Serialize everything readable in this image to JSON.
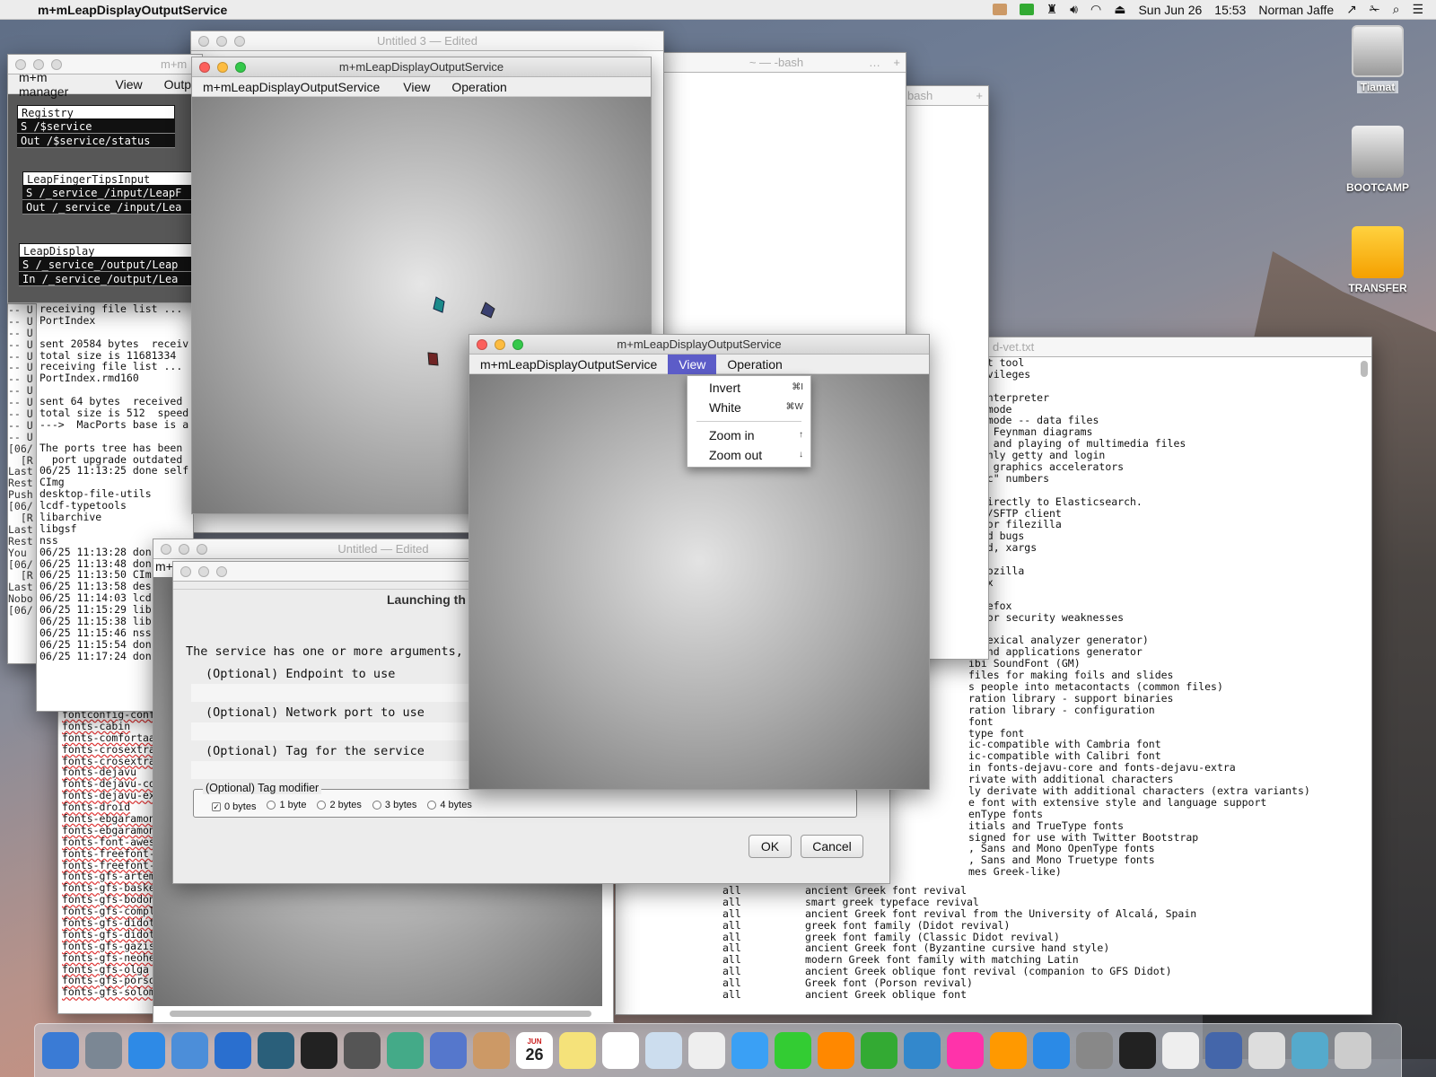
{
  "menubar": {
    "app": "m+mLeapDisplayOutputService",
    "date": "Sun Jun 26",
    "time": "15:53",
    "user": "Norman Jaffe"
  },
  "desktop_icons": [
    {
      "label": "Tiamat"
    },
    {
      "label": "BOOTCAMP"
    },
    {
      "label": "TRANSFER"
    }
  ],
  "manager": {
    "title": "m+m",
    "menu": [
      "m+m manager",
      "View",
      "Outp"
    ],
    "registry": {
      "header": "Registry",
      "lines": [
        "S /$service",
        "Out /$service/status"
      ]
    },
    "fingertips": {
      "header": "LeapFingerTipsInput",
      "lines": [
        "S /_service_/input/LeapF",
        "Out /_service_/input/Lea"
      ]
    },
    "display": {
      "header": "LeapDisplay",
      "lines": [
        "S /_service_/output/Leap",
        "In /_service_/output/Lea"
      ]
    }
  },
  "term_left": {
    "lines": [
      "-- U",
      "-- U",
      "-- U",
      "-- U",
      "-- U",
      "-- U",
      "-- U",
      "-- U",
      "-- U",
      "-- U",
      "-- U",
      "-- U",
      "[06/",
      "  [R",
      "Last",
      "Rest",
      "Push",
      "[06/",
      "  [R",
      "Last",
      "Rest",
      "You ",
      "[06/",
      "  [R",
      "Last",
      "Nobo",
      "[06/"
    ]
  },
  "term_mid": {
    "lines": [
      "receiving file list ...",
      "PortIndex",
      "",
      "sent 20584 bytes  receiv",
      "total size is 11681334",
      "receiving file list ...",
      "PortIndex.rmd160",
      "",
      "sent 64 bytes  received",
      "total size is 512  speed",
      "--->  MacPorts base is a",
      "",
      "The ports tree has been",
      "  port upgrade outdated",
      "06/25 11:13:25 done self",
      "CImg",
      "desktop-file-utils",
      "lcdf-typetools",
      "libarchive",
      "libgsf",
      "nss",
      "06/25 11:13:28 don",
      "06/25 11:13:48 don",
      "06/25 11:13:50 CIm",
      "06/25 11:13:58 des",
      "06/25 11:14:03 lcd",
      "06/25 11:15:29 lib",
      "06/25 11:15:38 lib",
      "06/25 11:15:46 nss",
      "06/25 11:15:54 don",
      "06/25 11:17:24 don"
    ]
  },
  "term_fonts": {
    "lines": [
      "fontconfig-conf",
      "fonts-cabin",
      "fonts-comfortaa",
      "fonts-crosextra",
      "fonts-crosextra",
      "fonts-dejavu",
      "fonts-dejavu-co",
      "fonts-dejavu-ex",
      "fonts-droid",
      "fonts-ebgaramon",
      "fonts-ebgaramon",
      "fonts-font-awes",
      "fonts-freefont-",
      "fonts-freefont-",
      "fonts-gfs-artem",
      "fonts-gfs-baske",
      "fonts-gfs-bodon",
      "fonts-gfs-compl",
      "fonts-gfs-didot",
      "fonts-gfs-didot",
      "fonts-gfs-gazis",
      "fonts-gfs-neohe",
      "fonts-gfs-olga",
      "fonts-gfs-porso",
      "fonts-gfs-solom"
    ]
  },
  "bash_window": {
    "title": "~ — -bash",
    "tab2": "bash"
  },
  "untitled3": {
    "title": "Untitled 3",
    "status": "— Edited"
  },
  "untitled": {
    "title": "Untitled",
    "status": "— Edited",
    "menu_frag": "m+"
  },
  "editor_text": {
    "title": "d-vet.txt",
    "lines": [
      "ment tool",
      "privileges",
      "",
      "d interpreter",
      "er mode",
      "er mode -- data files",
      "ing Feynman diagrams",
      "ing and playing of multimedia files",
      "e-only getty and login",
      "AMD graphics accelerators",
      "agic\" numbers",
      "",
      "r directly to Elasticsearch.",
      "TPS/SFTP client",
      "s for filezilla",
      "find bugs",
      "find, xargs",
      "am",
      "n Mozilla",
      "efox",
      "fox",
      "Firefox",
      "s for security weaknesses",
      "or",
      ": lexical analyzer generator)",
      "s and applications generator",
      "ibi SoundFont (GM)",
      "files for making foils and slides",
      "s people into metacontacts (common files)",
      "ration library - support binaries",
      "ration library - configuration",
      "font",
      "type font",
      "ic-compatible with Cambria font",
      "ic-compatible with Calibri font",
      "in fonts-dejavu-core and fonts-dejavu-extra",
      "rivate with additional characters",
      "ly derivate with additional characters (extra variants)",
      "e font with extensive style and language support",
      "enType fonts",
      "itials and TrueType fonts",
      "signed for use with Twitter Bootstrap",
      ", Sans and Mono OpenType fonts",
      ", Sans and Mono Truetype fonts",
      "mes Greek-like)"
    ],
    "rows": [
      [
        "all",
        "ancient Greek font revival"
      ],
      [
        "all",
        "smart greek typeface revival"
      ],
      [
        "all",
        "ancient Greek font revival from the University of Alcalá, Spain"
      ],
      [
        "all",
        "greek font family (Didot revival)"
      ],
      [
        "all",
        "greek font family (Classic Didot revival)"
      ],
      [
        "all",
        "ancient Greek font (Byzantine cursive hand style)"
      ],
      [
        "all",
        "modern Greek font family with matching Latin"
      ],
      [
        "all",
        "ancient Greek oblique font revival (companion to GFS Didot)"
      ],
      [
        "all",
        "Greek font (Porson revival)"
      ],
      [
        "all",
        "ancient Greek oblique font"
      ]
    ]
  },
  "leap_main": {
    "title": "m+mLeapDisplayOutputService",
    "menu": [
      "m+mLeapDisplayOutputService",
      "View",
      "Operation"
    ]
  },
  "leap_front": {
    "title": "m+mLeapDisplayOutputService",
    "menu": [
      "m+mLeapDisplayOutputService",
      "View",
      "Operation"
    ]
  },
  "view_menu": {
    "items": [
      {
        "label": "Invert",
        "shortcut": "⌘I"
      },
      {
        "label": "White",
        "shortcut": "⌘W"
      },
      {
        "label": "Zoom in",
        "shortcut": "↑"
      },
      {
        "label": "Zoom out",
        "shortcut": "↓"
      }
    ]
  },
  "dialog": {
    "title": "Launching th",
    "message": "The service has one or more arguments,",
    "fields": [
      "(Optional) Endpoint to use",
      "(Optional) Network port to use",
      "(Optional) Tag for the service"
    ],
    "modifier": {
      "label": "(Optional) Tag modifier",
      "options": [
        "0 bytes",
        "1 byte",
        "2 bytes",
        "3 bytes",
        "4 bytes"
      ],
      "selected": "0 bytes"
    },
    "ok": "OK",
    "cancel": "Cancel"
  },
  "dock": {
    "items": [
      "finder",
      "launchpad",
      "safari",
      "xcode",
      "visual-studio-code",
      "sourcetree",
      "terminal",
      "mm-1",
      "mm-2",
      "mm-3",
      "contacts",
      "calendar",
      "notes",
      "reminders",
      "preview",
      "photos",
      "messages",
      "facetime",
      "pages",
      "numbers",
      "keynote",
      "itunes",
      "ibooks",
      "app-store",
      "system-preferences",
      "activity-monitor",
      "textedit",
      "leap-app",
      "grapher",
      "downloads",
      "trash"
    ],
    "calendar_day": "26",
    "calendar_month": "JUN"
  },
  "colors": {
    "menu_highlight": "#5c5cc8",
    "terminal_teal": "#1b8a8a"
  }
}
